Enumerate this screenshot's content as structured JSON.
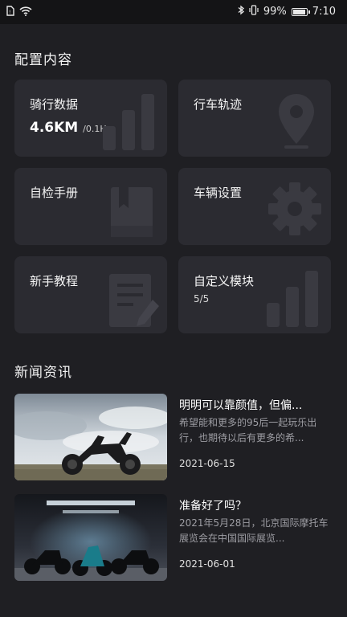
{
  "status_bar": {
    "battery_percent_text": "99%",
    "battery_level": 0.99,
    "time": "7:10",
    "icons": [
      "sim-icon",
      "wifi-icon",
      "bluetooth-icon",
      "vibrate-icon",
      "battery-icon"
    ]
  },
  "config": {
    "title": "配置内容",
    "cards": [
      {
        "label": "骑行数据",
        "value": "4.6KM",
        "unit": "/0.1H",
        "icon": "bar-chart-icon"
      },
      {
        "label": "行车轨迹",
        "icon": "location-pin-icon"
      },
      {
        "label": "自检手册",
        "icon": "book-icon"
      },
      {
        "label": "车辆设置",
        "icon": "gear-icon"
      },
      {
        "label": "新手教程",
        "icon": "document-pen-icon"
      },
      {
        "label": "自定义模块",
        "sub": "5/5",
        "icon": "bar-chart-icon"
      }
    ]
  },
  "news": {
    "title": "新闻资讯",
    "items": [
      {
        "title": "明明可以靠颜值，但偏...",
        "desc": "希望能和更多的95后一起玩乐出行，也期待以后有更多的希...",
        "date": "2021-06-15"
      },
      {
        "title": "准备好了吗？",
        "desc": "2021年5月28日，北京国际摩托车展览会在中国国际展览...",
        "date": "2021-06-01"
      }
    ]
  },
  "colors": {
    "background": "#1f1f23",
    "card": "#2b2b31",
    "accent_text": "#ffffff",
    "muted_text": "#9d9da3"
  }
}
